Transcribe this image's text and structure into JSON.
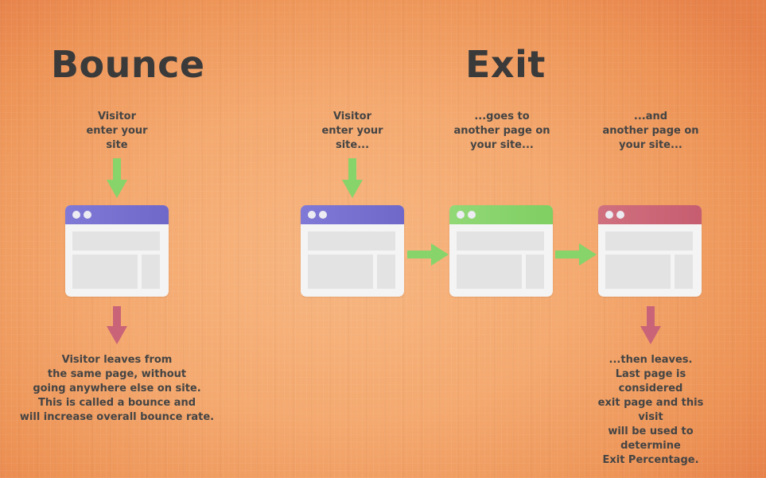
{
  "colors": {
    "text": "#3d3d3d",
    "purple_header": "#7b72d0",
    "green_header": "#86d46a",
    "red_header": "#cb6478",
    "green_arrow": "#86d46a",
    "red_arrow": "#c96478",
    "window_body": "#f4f4f4",
    "window_block": "#e3e3e3"
  },
  "bounce": {
    "title": "Bounce",
    "enter_caption": "Visitor\nenter your\nsite",
    "enter_arrow_icon": "arrow-down-green",
    "window": {
      "header_color": "purple",
      "icon": "browser-window-icon"
    },
    "leave_arrow_icon": "arrow-down-red",
    "leave_caption": "Visitor leaves from\nthe same page, without\ngoing anywhere else on site.\nThis is called a bounce and\nwill increase overall bounce rate."
  },
  "exit": {
    "title": "Exit",
    "steps": [
      {
        "caption": "Visitor\nenter your\nsite...",
        "header_color": "purple",
        "arrow_in": "arrow-down-green"
      },
      {
        "caption": "...goes to\nanother page on\nyour site...",
        "header_color": "green",
        "arrow_in": "arrow-right-green"
      },
      {
        "caption": "...and\nanother page on\nyour site...",
        "header_color": "red",
        "arrow_in": "arrow-right-green"
      }
    ],
    "leave_arrow_icon": "arrow-down-red",
    "leave_caption": "...then leaves.\nLast page is considered\nexit page and this visit\nwill be used to determine\nExit Percentage."
  }
}
